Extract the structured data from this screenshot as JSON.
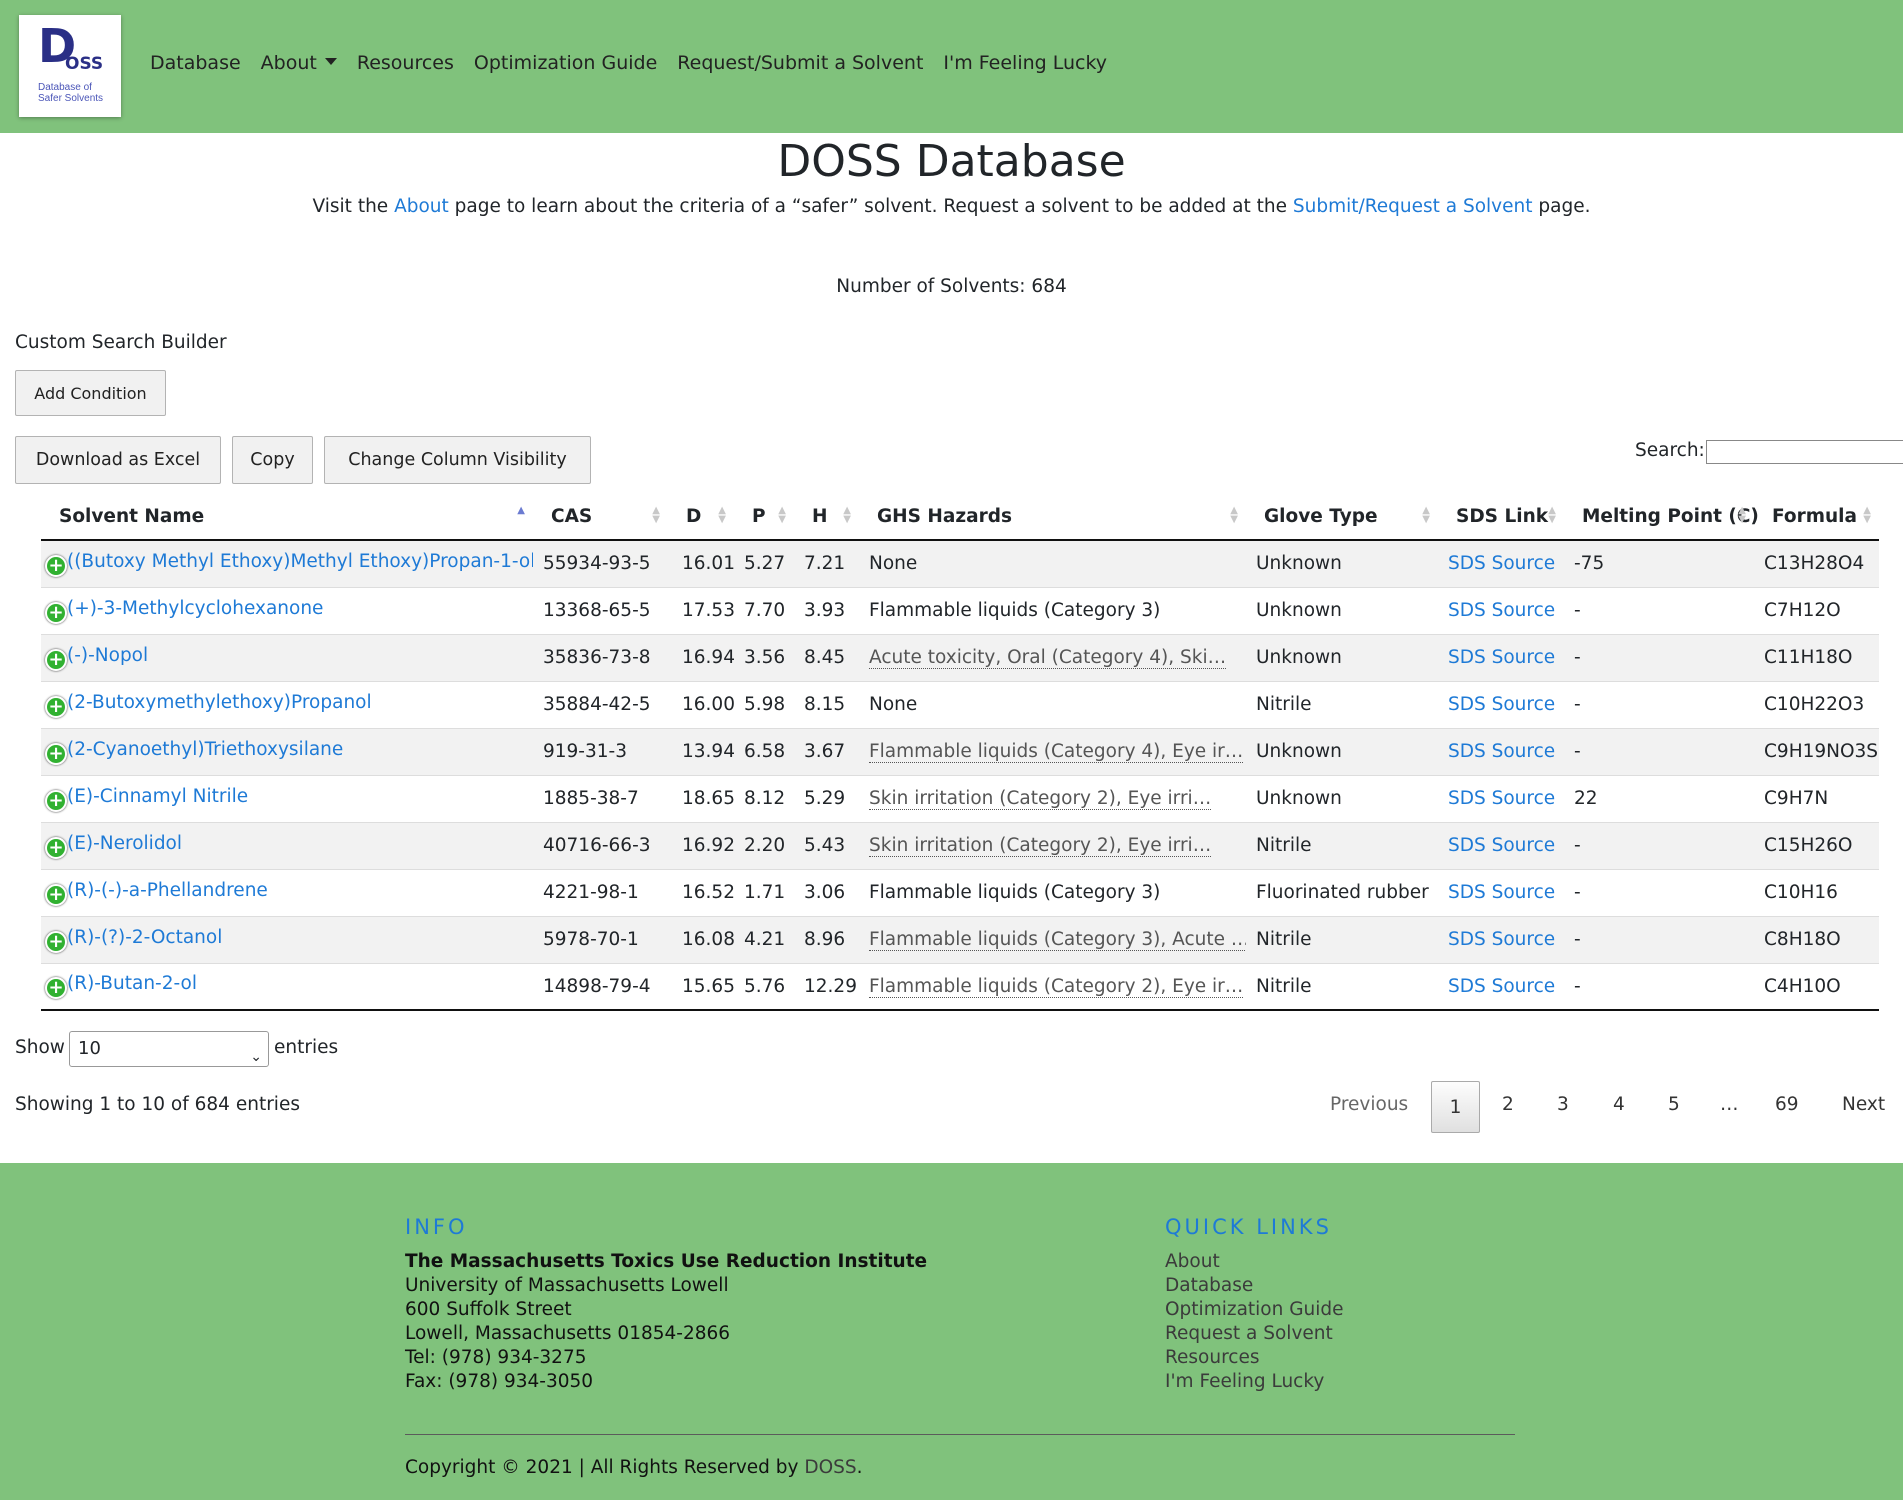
{
  "nav": {
    "logo_big": "D",
    "logo_oss": "OSS",
    "logo_sub1": "Database of",
    "logo_sub2": "Safer Solvents",
    "items": [
      "Database",
      "About",
      "Resources",
      "Optimization Guide",
      "Request/Submit a Solvent",
      "I'm Feeling Lucky"
    ]
  },
  "header": {
    "title": "DOSS Database",
    "intro_1": "Visit the ",
    "intro_link_1": "About",
    "intro_2": " page to learn about the criteria of a “safer” solvent. Request a solvent to be added at the ",
    "intro_link_2": "Submit/Request a Solvent",
    "intro_3": " page.",
    "count": "Number of Solvents: 684"
  },
  "controls": {
    "csb_title": "Custom Search Builder",
    "add_condition": "Add Condition",
    "download": "Download as Excel",
    "copy": "Copy",
    "visibility": "Change Column Visibility",
    "search_label": "Search:"
  },
  "table": {
    "columns": [
      "Solvent Name",
      "CAS",
      "D",
      "P",
      "H",
      "GHS Hazards",
      "Glove Type",
      "SDS Link",
      "Melting Point (C)",
      "Formula"
    ],
    "rows": [
      {
        "name": "((Butoxy Methyl Ethoxy)Methyl Ethoxy)Propan-1-ol",
        "cas": "55934-93-5",
        "d": "16.01",
        "p": "5.27",
        "h": "7.21",
        "ghs": "None",
        "ghs_trunc": false,
        "glove": "Unknown",
        "sds": "SDS Source",
        "mp": "-75",
        "formula": "C13H28O4"
      },
      {
        "name": "(+)-3-Methylcyclohexanone",
        "cas": "13368-65-5",
        "d": "17.53",
        "p": "7.70",
        "h": "3.93",
        "ghs": "Flammable liquids (Category 3)",
        "ghs_trunc": false,
        "glove": "Unknown",
        "sds": "SDS Source",
        "mp": "-",
        "formula": "C7H12O"
      },
      {
        "name": "(-)-Nopol",
        "cas": "35836-73-8",
        "d": "16.94",
        "p": "3.56",
        "h": "8.45",
        "ghs": "Acute toxicity, Oral (Category 4), Ski…",
        "ghs_trunc": true,
        "glove": "Unknown",
        "sds": "SDS Source",
        "mp": "-",
        "formula": "C11H18O"
      },
      {
        "name": "(2-Butoxymethylethoxy)Propanol",
        "cas": "35884-42-5",
        "d": "16.00",
        "p": "5.98",
        "h": "8.15",
        "ghs": "None",
        "ghs_trunc": false,
        "glove": "Nitrile",
        "sds": "SDS Source",
        "mp": "-",
        "formula": "C10H22O3"
      },
      {
        "name": "(2-Cyanoethyl)Triethoxysilane",
        "cas": "919-31-3",
        "d": "13.94",
        "p": "6.58",
        "h": "3.67",
        "ghs": "Flammable liquids (Category 4), Eye ir…",
        "ghs_trunc": true,
        "glove": "Unknown",
        "sds": "SDS Source",
        "mp": "-",
        "formula": "C9H19NO3Si"
      },
      {
        "name": "(E)-Cinnamyl Nitrile",
        "cas": "1885-38-7",
        "d": "18.65",
        "p": "8.12",
        "h": "5.29",
        "ghs": "Skin irritation (Category 2), Eye irri…",
        "ghs_trunc": true,
        "glove": "Unknown",
        "sds": "SDS Source",
        "mp": "22",
        "formula": "C9H7N"
      },
      {
        "name": "(E)-Nerolidol",
        "cas": "40716-66-3",
        "d": "16.92",
        "p": "2.20",
        "h": "5.43",
        "ghs": "Skin irritation (Category 2), Eye irri…",
        "ghs_trunc": true,
        "glove": "Nitrile",
        "sds": "SDS Source",
        "mp": "-",
        "formula": "C15H26O"
      },
      {
        "name": "(R)-(-)-a-Phellandrene",
        "cas": "4221-98-1",
        "d": "16.52",
        "p": "1.71",
        "h": "3.06",
        "ghs": "Flammable liquids (Category 3)",
        "ghs_trunc": false,
        "glove": "Fluorinated rubber",
        "sds": "SDS Source",
        "mp": "-",
        "formula": "C10H16"
      },
      {
        "name": "(R)-(?)-2-Octanol",
        "cas": "5978-70-1",
        "d": "16.08",
        "p": "4.21",
        "h": "8.96",
        "ghs": "Flammable liquids (Category 3), Acute …",
        "ghs_trunc": true,
        "glove": "Nitrile",
        "sds": "SDS Source",
        "mp": "-",
        "formula": "C8H18O"
      },
      {
        "name": "(R)-Butan-2-ol",
        "cas": "14898-79-4",
        "d": "15.65",
        "p": "5.76",
        "h": "12.29",
        "ghs": "Flammable liquids (Category 2), Eye ir…",
        "ghs_trunc": true,
        "glove": "Nitrile",
        "sds": "SDS Source",
        "mp": "-",
        "formula": "C4H10O"
      }
    ]
  },
  "paging": {
    "show": "Show",
    "length_value": "10",
    "entries": "entries",
    "info": "Showing 1 to 10 of 684 entries",
    "previous": "Previous",
    "pages": [
      "1",
      "2",
      "3",
      "4",
      "5",
      "…",
      "69"
    ],
    "next": "Next"
  },
  "footer": {
    "info_head": "INFO",
    "org": "The Massachusetts Toxics Use Reduction Institute",
    "address": [
      "University of Massachusetts Lowell",
      "600 Suffolk Street",
      "Lowell, Massachusetts 01854-2866",
      "Tel: (978) 934-3275",
      "Fax: (978) 934-3050"
    ],
    "links_head": "QUICK LINKS",
    "links": [
      "About",
      "Database",
      "Optimization Guide",
      "Request a Solvent",
      "Resources",
      "I'm Feeling Lucky"
    ],
    "copyright": "Copyright © 2021 | All Rights Reserved by ",
    "copyright_link": "DOSS",
    "copyright_end": "."
  },
  "colors": {
    "green_bar": "#80c27c",
    "link": "#1e7ad6",
    "logo": "#2a2f86"
  }
}
